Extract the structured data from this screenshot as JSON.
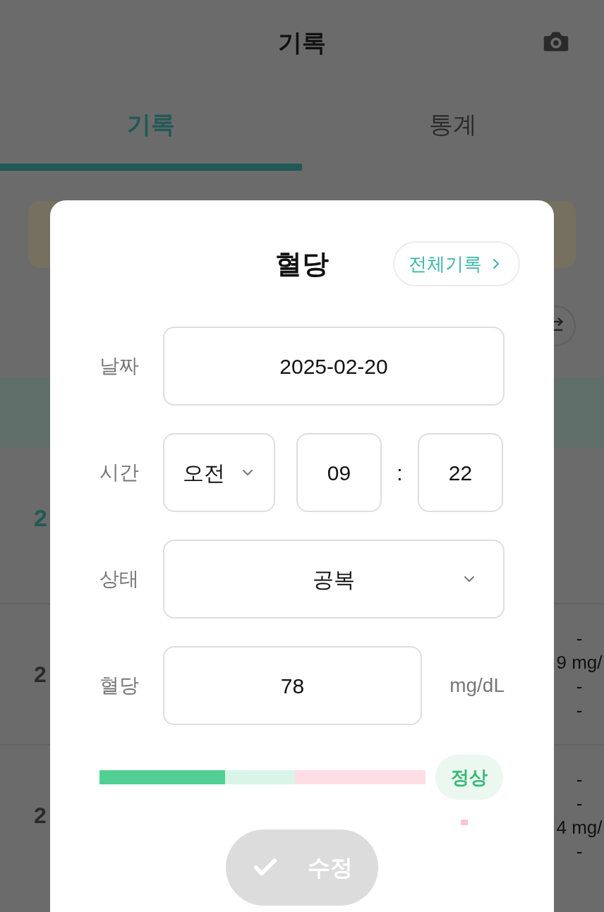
{
  "header": {
    "title": "기록"
  },
  "tabs": [
    {
      "label": "기록",
      "selected": true
    },
    {
      "label": "통계",
      "selected": false
    }
  ],
  "background": {
    "list_date": "2",
    "entries": [
      {
        "date": "2",
        "lines": [
          "-",
          "9 mg/",
          "-",
          "-"
        ]
      },
      {
        "date": "2",
        "lines": [
          "-",
          "-",
          "4 mg/",
          "-"
        ]
      }
    ]
  },
  "modal": {
    "title": "혈당",
    "link": "전체기록",
    "fields": [
      {
        "kind": "date",
        "label": "날짜",
        "value": "2025-02-20"
      },
      {
        "kind": "time",
        "label": "시간",
        "period": "오전",
        "hour": "09",
        "separator": ":",
        "minute": "22"
      },
      {
        "kind": "select",
        "label": "상태",
        "value": "공복"
      },
      {
        "kind": "number",
        "label": "혈당",
        "value": "78",
        "unit": "mg/dL"
      }
    ],
    "gauge": {
      "level": 0.385,
      "status": "정상"
    },
    "submit": {
      "label": "수정",
      "disabled": true
    }
  }
}
